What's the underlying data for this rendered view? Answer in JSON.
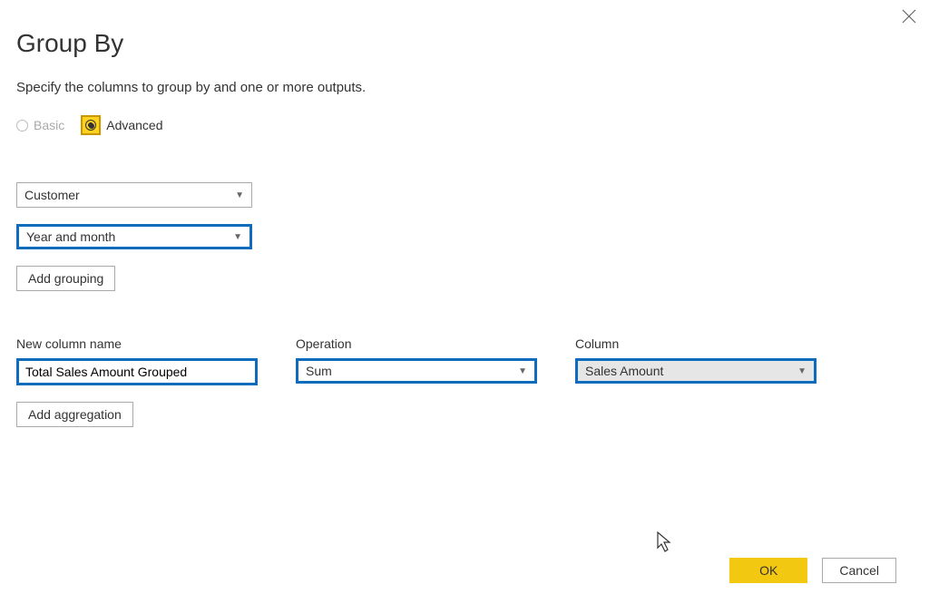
{
  "dialog": {
    "title": "Group By",
    "subtitle": "Specify the columns to group by and one or more outputs."
  },
  "mode": {
    "basic_label": "Basic",
    "advanced_label": "Advanced"
  },
  "groupings": {
    "items": [
      {
        "label": "Customer"
      },
      {
        "label": "Year and month"
      }
    ],
    "add_button": "Add grouping"
  },
  "aggregation": {
    "headers": {
      "new_column": "New column name",
      "operation": "Operation",
      "column": "Column"
    },
    "row": {
      "new_column_value": "Total Sales Amount Grouped",
      "operation_value": "Sum",
      "column_value": "Sales Amount"
    },
    "add_button": "Add aggregation"
  },
  "footer": {
    "ok": "OK",
    "cancel": "Cancel"
  }
}
